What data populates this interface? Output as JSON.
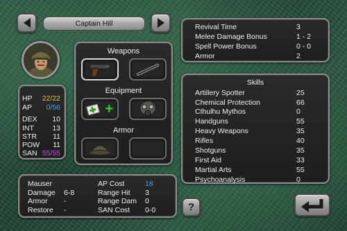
{
  "header": {
    "character_name": "Captain Hill"
  },
  "stats": [
    {
      "label": "HP",
      "value": "22/22",
      "color": "#e6c23a"
    },
    {
      "label": "AP",
      "value": "0/56",
      "color": "#4fa3e8"
    },
    {
      "label": "DEX",
      "value": "10",
      "color": "#f0f0f0"
    },
    {
      "label": "INT",
      "value": "13",
      "color": "#f0f0f0"
    },
    {
      "label": "STR",
      "value": "11",
      "color": "#f0f0f0"
    },
    {
      "label": "POW",
      "value": "11",
      "color": "#f0f0f0"
    },
    {
      "label": "SAN",
      "value": "55/55",
      "color": "#d04fe0"
    }
  ],
  "equipment_panel": {
    "weapons_label": "Weapons",
    "equipment_label": "Equipment",
    "armor_label": "Armor",
    "weapons": [
      {
        "icon": "pistol-icon",
        "selected": true
      },
      {
        "icon": "baton-icon",
        "selected": false
      }
    ],
    "equipment": [
      {
        "icon": "first-aid-kit-icon",
        "extra_icon": "plus-icon"
      },
      {
        "icon": "gas-mask-icon"
      }
    ],
    "armor": [
      {
        "icon": "helmet-icon"
      },
      {
        "icon": "empty-slot"
      }
    ],
    "plus_color": "#2fd32f"
  },
  "bonuses": [
    {
      "label": "Revival Time",
      "value": "3"
    },
    {
      "label": "Melee Damage Bonus",
      "value": "1 - 2"
    },
    {
      "label": "Spell Power Bonus",
      "value": "0 - 0"
    },
    {
      "label": "Armor",
      "value": "2"
    }
  ],
  "skills": {
    "title": "Skills",
    "items": [
      {
        "name": "Artillery Spotter",
        "value": "25"
      },
      {
        "name": "Chemical Protection",
        "value": "66"
      },
      {
        "name": "Cthulhu Mythos",
        "value": "0"
      },
      {
        "name": "Handguns",
        "value": "55"
      },
      {
        "name": "Heavy Weapons",
        "value": "35"
      },
      {
        "name": "Rifles",
        "value": "40"
      },
      {
        "name": "Shotguns",
        "value": "35"
      },
      {
        "name": "First Aid",
        "value": "33"
      },
      {
        "name": "Martial Arts",
        "value": "55"
      },
      {
        "name": "Psychoanalysis",
        "value": "0"
      }
    ]
  },
  "weapon_info": {
    "left": [
      {
        "label": "Mauser",
        "value": ""
      },
      {
        "label": "Damage",
        "value": "6-8"
      },
      {
        "label": "Armor",
        "value": "-"
      },
      {
        "label": "Restore",
        "value": "-"
      }
    ],
    "right": [
      {
        "label": "AP Cost",
        "value": "18",
        "color": "#4fa3e8"
      },
      {
        "label": "Range Hit",
        "value": "3",
        "color": "#f0f0f0"
      },
      {
        "label": "Range Dam",
        "value": "0",
        "color": "#f0f0f0"
      },
      {
        "label": "SAN Cost",
        "value": "0-0",
        "color": "#f0f0f0"
      }
    ]
  },
  "buttons": {
    "help_label": "?",
    "prev_icon": "arrow-left-icon",
    "next_icon": "arrow-right-icon",
    "back_icon": "return-arrow-icon"
  }
}
